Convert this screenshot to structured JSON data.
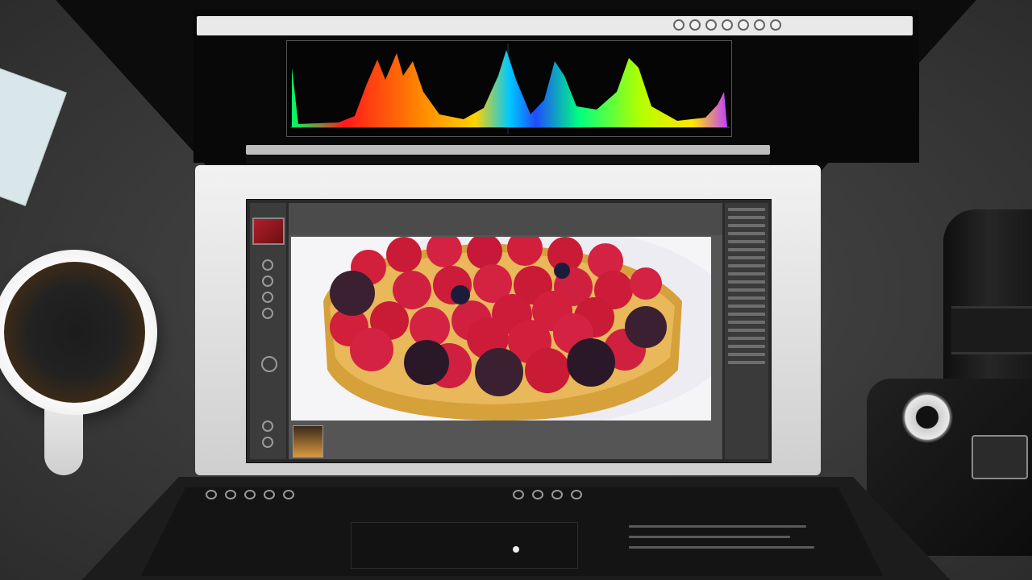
{
  "desk": {
    "coffee_cup": "coffee-cup",
    "camera": "dslr-camera"
  },
  "laptop": {
    "histogram": {
      "colors": [
        "#ff1a1a",
        "#ff8a00",
        "#ffd200",
        "#00c8ff",
        "#1f4dff",
        "#00ff80",
        "#b4ff00",
        "#c040ff"
      ]
    },
    "photo_subject": "berry-tart",
    "topbar_buttons": 7
  },
  "icons": {
    "search": "search-icon",
    "settings": "gear-icon",
    "navigator": "compass-icon"
  }
}
